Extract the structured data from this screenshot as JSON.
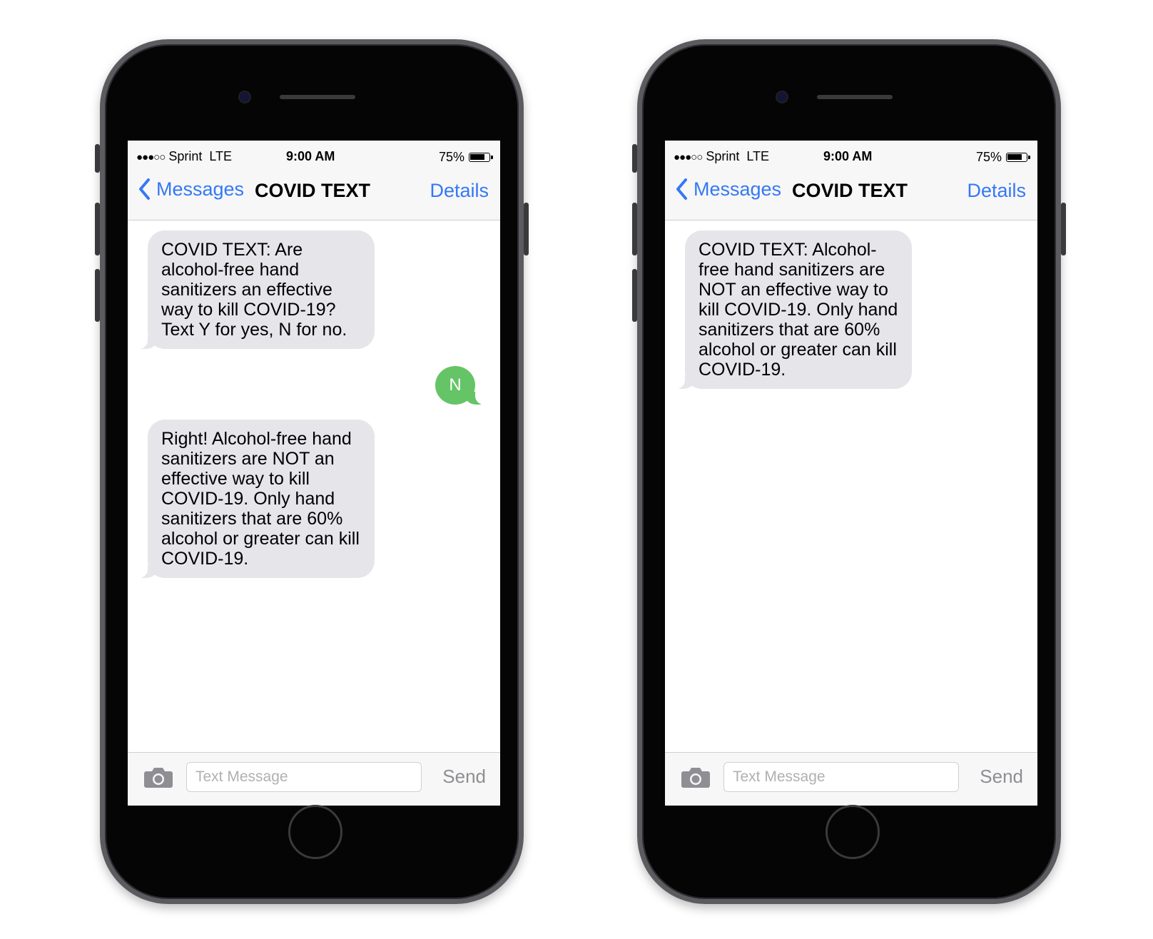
{
  "phones": [
    {
      "status": {
        "signal": "●●●○○",
        "carrier": "Sprint",
        "network": "LTE",
        "time": "9:00 AM",
        "battery": "75%",
        "battery_level": 0.75
      },
      "nav": {
        "back_label": "Messages",
        "title": "COVID TEXT",
        "details_label": "Details"
      },
      "messages": [
        {
          "direction": "in",
          "lines": [
            "COVID TEXT: Are",
            "alcohol-free hand",
            "sanitizers an effective",
            "way to kill COVID-19?",
            "Text Y for yes, N for no."
          ]
        },
        {
          "direction": "out",
          "text": "N"
        },
        {
          "direction": "in",
          "lines": [
            "Right! Alcohol-free hand",
            "sanitizers are NOT an",
            "effective way to kill",
            "COVID-19. Only hand",
            "sanitizers that are 60%",
            "alcohol or greater can kill",
            "COVID-19."
          ]
        }
      ],
      "compose": {
        "placeholder": "Text Message",
        "send_label": "Send"
      }
    },
    {
      "status": {
        "signal": "●●●○○",
        "carrier": "Sprint",
        "network": "LTE",
        "time": "9:00 AM",
        "battery": "75%",
        "battery_level": 0.75
      },
      "nav": {
        "back_label": "Messages",
        "title": "COVID TEXT",
        "details_label": "Details"
      },
      "messages": [
        {
          "direction": "in",
          "lines": [
            "COVID TEXT: Alcohol-",
            "free hand sanitizers are",
            "NOT an effective way to",
            "kill COVID-19. Only hand",
            "sanitizers that are 60%",
            "alcohol or greater can kill",
            "COVID-19."
          ]
        }
      ],
      "compose": {
        "placeholder": "Text Message",
        "send_label": "Send"
      }
    }
  ],
  "colors": {
    "ios_blue": "#3478f6",
    "incoming_bubble": "#e5e5ea",
    "outgoing_bubble": "#65c466",
    "phone_frame": "#5c5c60"
  },
  "icons": {
    "back": "chevron-left-icon",
    "camera": "camera-icon"
  }
}
